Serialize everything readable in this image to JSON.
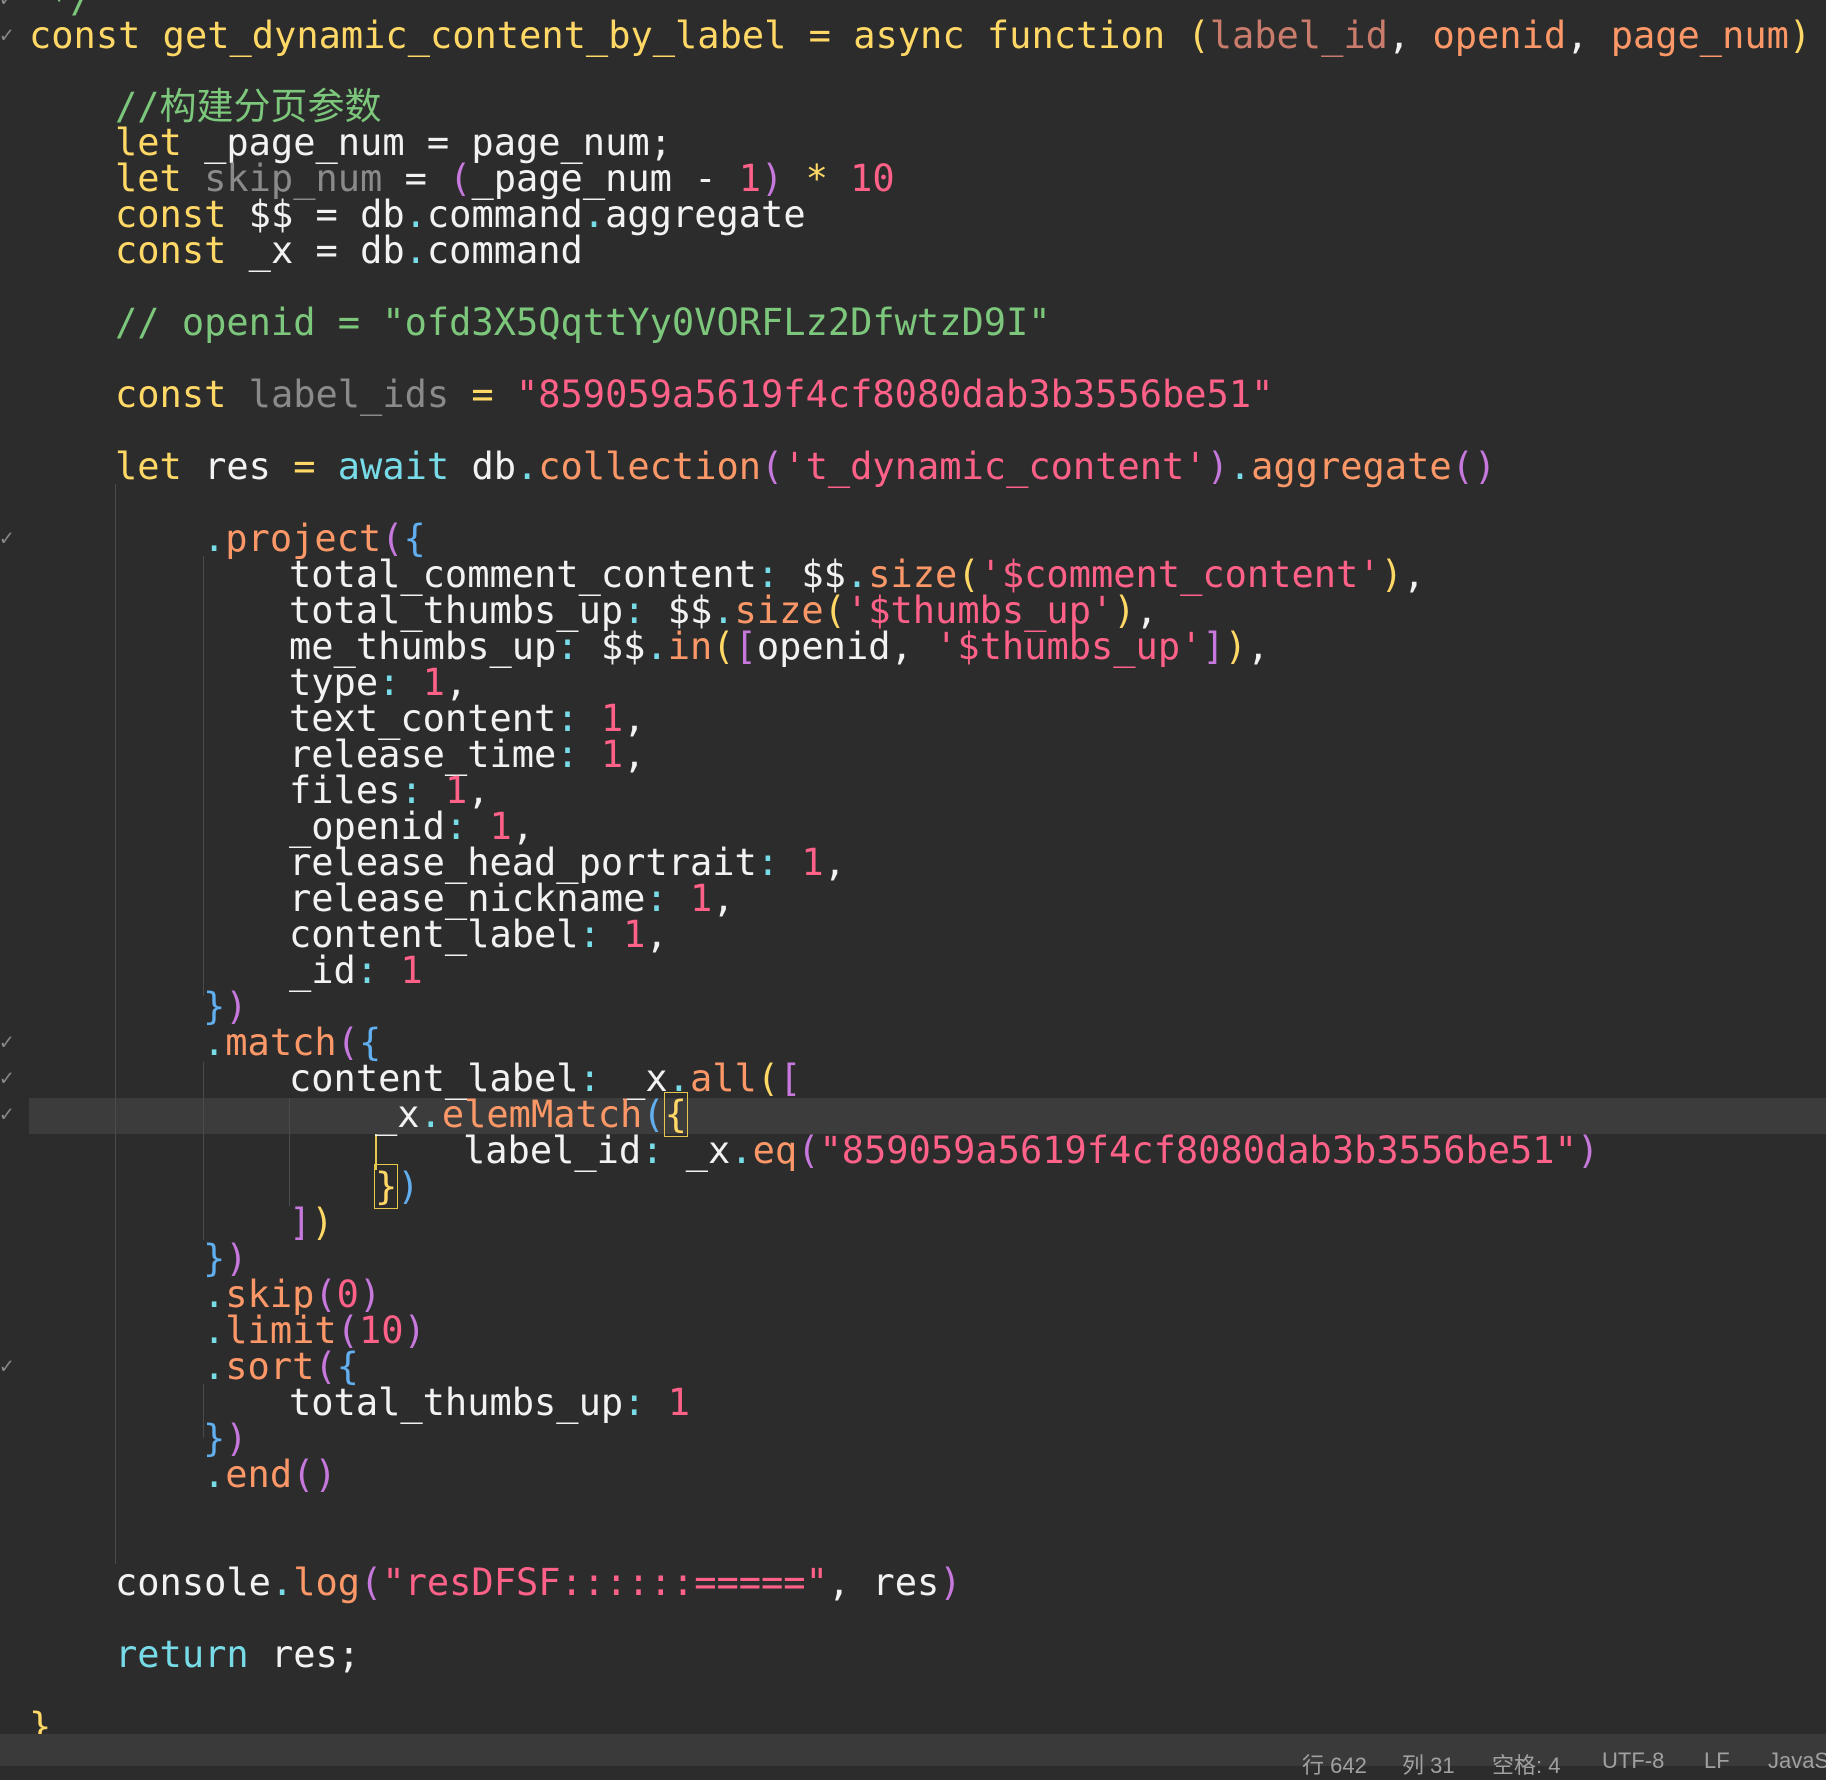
{
  "editor": {
    "lines": {
      "l0": "*/",
      "l1": {
        "kw_const": "const",
        "fn_name": "get_dynamic_content_by_label",
        "op_eq": " = ",
        "kw_async": "async",
        "kw_function": "function",
        "p_open": "(",
        "param1": "label_id",
        "comma1": ", ",
        "param2": "openid",
        "comma2": ", ",
        "param3": "page_num",
        "p_close": ")",
        "brace": "{"
      },
      "l2": "//构建分页参数",
      "l3": {
        "kw": "let",
        "var": "_page_num",
        "op": " = ",
        "val": "page_num",
        "end": ";"
      },
      "l4": {
        "kw": "let",
        "var": "skip_num",
        "op": " = ",
        "p_open": "(",
        "ref": "_page_num",
        "minus": " - ",
        "one": "1",
        "p_close": ")",
        "mul": " * ",
        "ten": "10"
      },
      "l5": {
        "kw": "const",
        "var": "$$",
        "op": " = ",
        "obj": "db",
        "dot1": ".",
        "prop1": "command",
        "dot2": ".",
        "prop2": "aggregate"
      },
      "l6": {
        "kw": "const",
        "var": "_x",
        "op": " = ",
        "obj": "db",
        "dot": ".",
        "prop": "command"
      },
      "l7": "// openid = \"ofd3X5QqttYy0VORFLz2DfwtzD9I\"",
      "l8": {
        "kw": "const",
        "var": "label_ids",
        "op": " = ",
        "str": "\"859059a5619f4cf8080dab3b3556be51\""
      },
      "l9": {
        "kw": "let",
        "var": "res",
        "op": " = ",
        "kw_await": "await",
        "obj": "db",
        "dot": ".",
        "m1": "collection",
        "p1o": "(",
        "str": "'t_dynamic_content'",
        "p1c": ")",
        "dot2": ".",
        "m2": "aggregate",
        "p2": "()"
      },
      "l10": {
        "dot": ".",
        "m": "project",
        "po": "(",
        "bo": "{"
      },
      "l11": {
        "key": "total_comment_content",
        "colon": ": ",
        "obj": "$$",
        "dot": ".",
        "m": "size",
        "po": "(",
        "str": "'$comment_content'",
        "pc": ")",
        "comma": ","
      },
      "l12": {
        "key": "total_thumbs_up",
        "colon": ": ",
        "obj": "$$",
        "dot": ".",
        "m": "size",
        "po": "(",
        "str": "'$thumbs_up'",
        "pc": ")",
        "comma": ","
      },
      "l13": {
        "key": "me_thumbs_up",
        "colon": ": ",
        "obj": "$$",
        "dot": ".",
        "m": "in",
        "po": "(",
        "bo": "[",
        "a1": "openid",
        "c": ", ",
        "str": "'$thumbs_up'",
        "bc": "]",
        "pc": ")",
        "comma": ","
      },
      "l14": {
        "key": "type",
        "colon": ": ",
        "val": "1",
        "comma": ","
      },
      "l15": {
        "key": "text_content",
        "colon": ": ",
        "val": "1",
        "comma": ","
      },
      "l16": {
        "key": "release_time",
        "colon": ": ",
        "val": "1",
        "comma": ","
      },
      "l17": {
        "key": "files",
        "colon": ": ",
        "val": "1",
        "comma": ","
      },
      "l18": {
        "key": "_openid",
        "colon": ": ",
        "val": "1",
        "comma": ","
      },
      "l19": {
        "key": "release_head_portrait",
        "colon": ": ",
        "val": "1",
        "comma": ","
      },
      "l20": {
        "key": "release_nickname",
        "colon": ": ",
        "val": "1",
        "comma": ","
      },
      "l21": {
        "key": "content_label",
        "colon": ": ",
        "val": "1",
        "comma": ","
      },
      "l22": {
        "key": "_id",
        "colon": ": ",
        "val": "1"
      },
      "l23": {
        "bc": "}",
        "pc": ")"
      },
      "l24": {
        "dot": ".",
        "m": "match",
        "po": "(",
        "bo": "{"
      },
      "l25": {
        "key": "content_label",
        "colon": ": ",
        "obj": "_x",
        "dot": ".",
        "m": "all",
        "po": "(",
        "bo": "["
      },
      "l26": {
        "obj": "_x",
        "dot": ".",
        "m": "elemMatch",
        "po": "(",
        "bo": "{"
      },
      "l27": {
        "key": "label_id",
        "colon": ": ",
        "obj": "_x",
        "dot": ".",
        "m": "eq",
        "po": "(",
        "str": "\"859059a5619f4cf8080dab3b3556be51\"",
        "pc": ")"
      },
      "l28": {
        "bc": "}",
        "pc": ")"
      },
      "l29": {
        "bc": "]",
        "pc": ")"
      },
      "l30": {
        "bc": "}",
        "pc": ")"
      },
      "l31": {
        "dot": ".",
        "m": "skip",
        "po": "(",
        "val": "0",
        "pc": ")"
      },
      "l32": {
        "dot": ".",
        "m": "limit",
        "po": "(",
        "val": "10",
        "pc": ")"
      },
      "l33": {
        "dot": ".",
        "m": "sort",
        "po": "(",
        "bo": "{"
      },
      "l34": {
        "key": "total_thumbs_up",
        "colon": ": ",
        "val": "1"
      },
      "l35": {
        "bc": "}",
        "pc": ")"
      },
      "l36": {
        "dot": ".",
        "m": "end",
        "p": "()"
      },
      "l37": {
        "obj": "console",
        "dot": ".",
        "m": "log",
        "po": "(",
        "str": "\"resDFSF::::::=====\"",
        "c": ", ",
        "a": "res",
        "pc": ")"
      },
      "l38": {
        "kw": "return",
        "val": "res",
        "end": ";"
      },
      "l39": "}"
    },
    "fold_marker": "✓"
  },
  "status_bar": {
    "line": "行 642",
    "col": "列 31",
    "spaces": "空格: 4",
    "encoding": "UTF-8",
    "eol": "LF",
    "language": "JavaS"
  },
  "colors": {
    "background": "#2c2c2c",
    "keyword": "#ffd866",
    "string": "#ff6188",
    "comment": "#7cc77c",
    "punctuation": "#78dce8",
    "parameter": "#fc9867"
  }
}
